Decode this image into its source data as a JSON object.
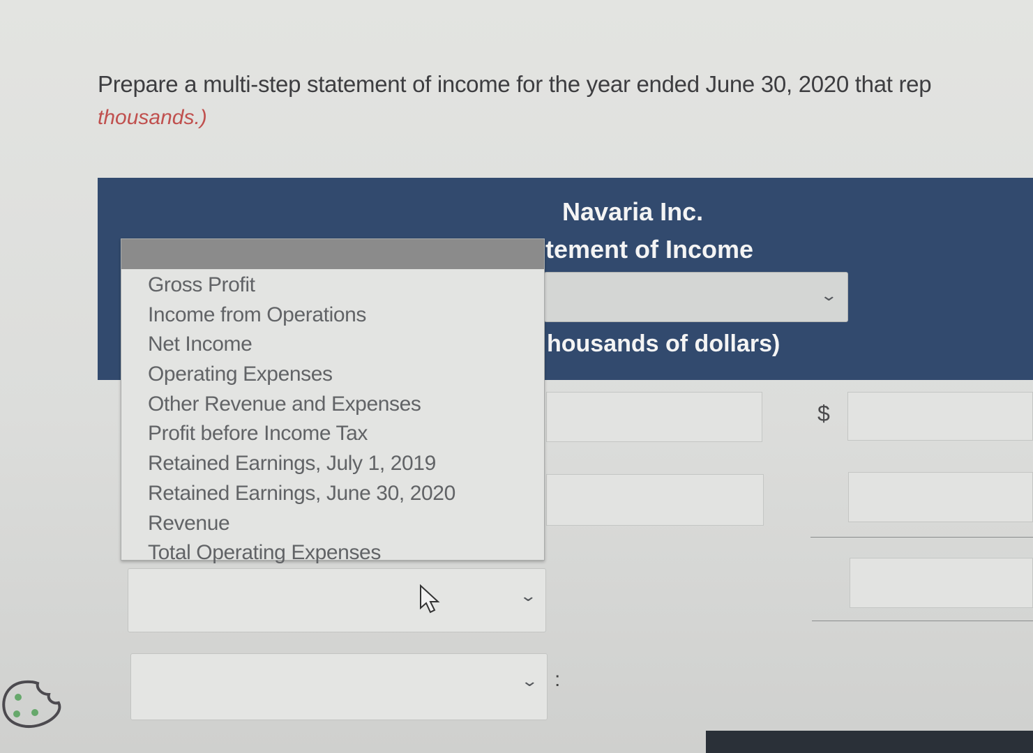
{
  "instruction": {
    "text": "Prepare a multi-step statement of income for the year ended June 30, 2020 that rep",
    "note": "thousands.)"
  },
  "statement_header": {
    "company": "Navaria Inc.",
    "title": "tement of Income",
    "period_select_value": "",
    "units": "housands of dollars)"
  },
  "dropdown": {
    "selected_value": "",
    "options": [
      "Gross Profit",
      "Income from Operations",
      "Net Income",
      "Operating Expenses",
      "Other Revenue and Expenses",
      "Profit before Income Tax",
      "Retained Earnings, July 1, 2019",
      "Retained Earnings, June 30, 2020",
      "Revenue",
      "Total Operating Expenses"
    ]
  },
  "rows": {
    "currency_symbol": "$",
    "row_select_values": [
      "",
      ""
    ],
    "trailing_colon": ":"
  },
  "colors": {
    "header_band": "#324a6e",
    "note_red": "#c0504e",
    "selected_option": "#8b8b8b"
  },
  "icons": [
    "chevron-down-icon",
    "mouse-pointer-icon",
    "cookie-icon"
  ]
}
